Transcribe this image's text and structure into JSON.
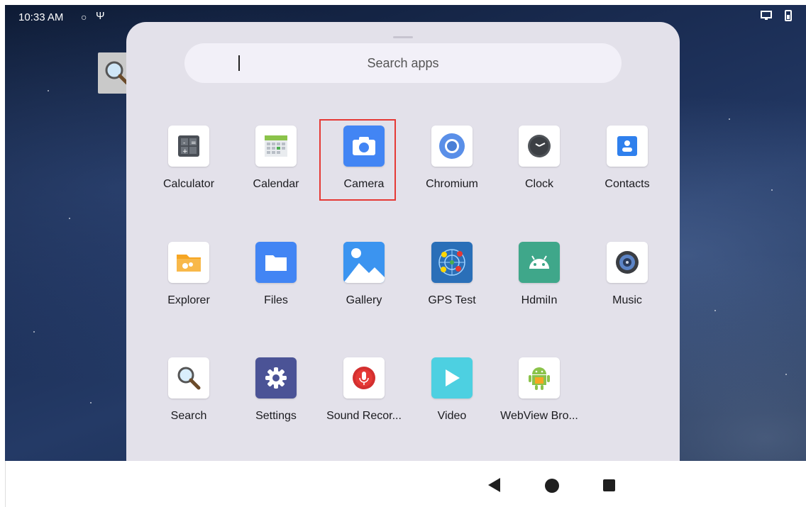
{
  "status_bar": {
    "time": "10:33 AM",
    "icons": [
      "sync-icon",
      "usb-icon",
      "cast-icon",
      "battery-icon"
    ]
  },
  "search": {
    "placeholder": "Search apps"
  },
  "apps": [
    {
      "label": "Calculator",
      "icon": "calculator-icon"
    },
    {
      "label": "Calendar",
      "icon": "calendar-icon"
    },
    {
      "label": "Camera",
      "icon": "camera-icon",
      "highlighted": true
    },
    {
      "label": "Chromium",
      "icon": "chromium-icon"
    },
    {
      "label": "Clock",
      "icon": "clock-icon"
    },
    {
      "label": "Contacts",
      "icon": "contacts-icon"
    },
    {
      "label": "Explorer",
      "icon": "explorer-icon"
    },
    {
      "label": "Files",
      "icon": "files-icon"
    },
    {
      "label": "Gallery",
      "icon": "gallery-icon"
    },
    {
      "label": "GPS Test",
      "icon": "gps-test-icon"
    },
    {
      "label": "HdmiIn",
      "icon": "hdmiin-icon"
    },
    {
      "label": "Music",
      "icon": "music-icon"
    },
    {
      "label": "Search",
      "icon": "search-icon"
    },
    {
      "label": "Settings",
      "icon": "settings-icon"
    },
    {
      "label": "Sound Recor...",
      "icon": "sound-recorder-icon"
    },
    {
      "label": "Video",
      "icon": "video-icon"
    },
    {
      "label": "WebView Bro...",
      "icon": "webview-browser-icon"
    }
  ],
  "navigation": [
    "back-icon",
    "home-icon",
    "recents-icon"
  ],
  "colors": {
    "drawer_bg": "#e3e1ea",
    "search_bg": "#f2f0f8",
    "highlight": "#e53935",
    "accent_blue": "#4285f4"
  }
}
